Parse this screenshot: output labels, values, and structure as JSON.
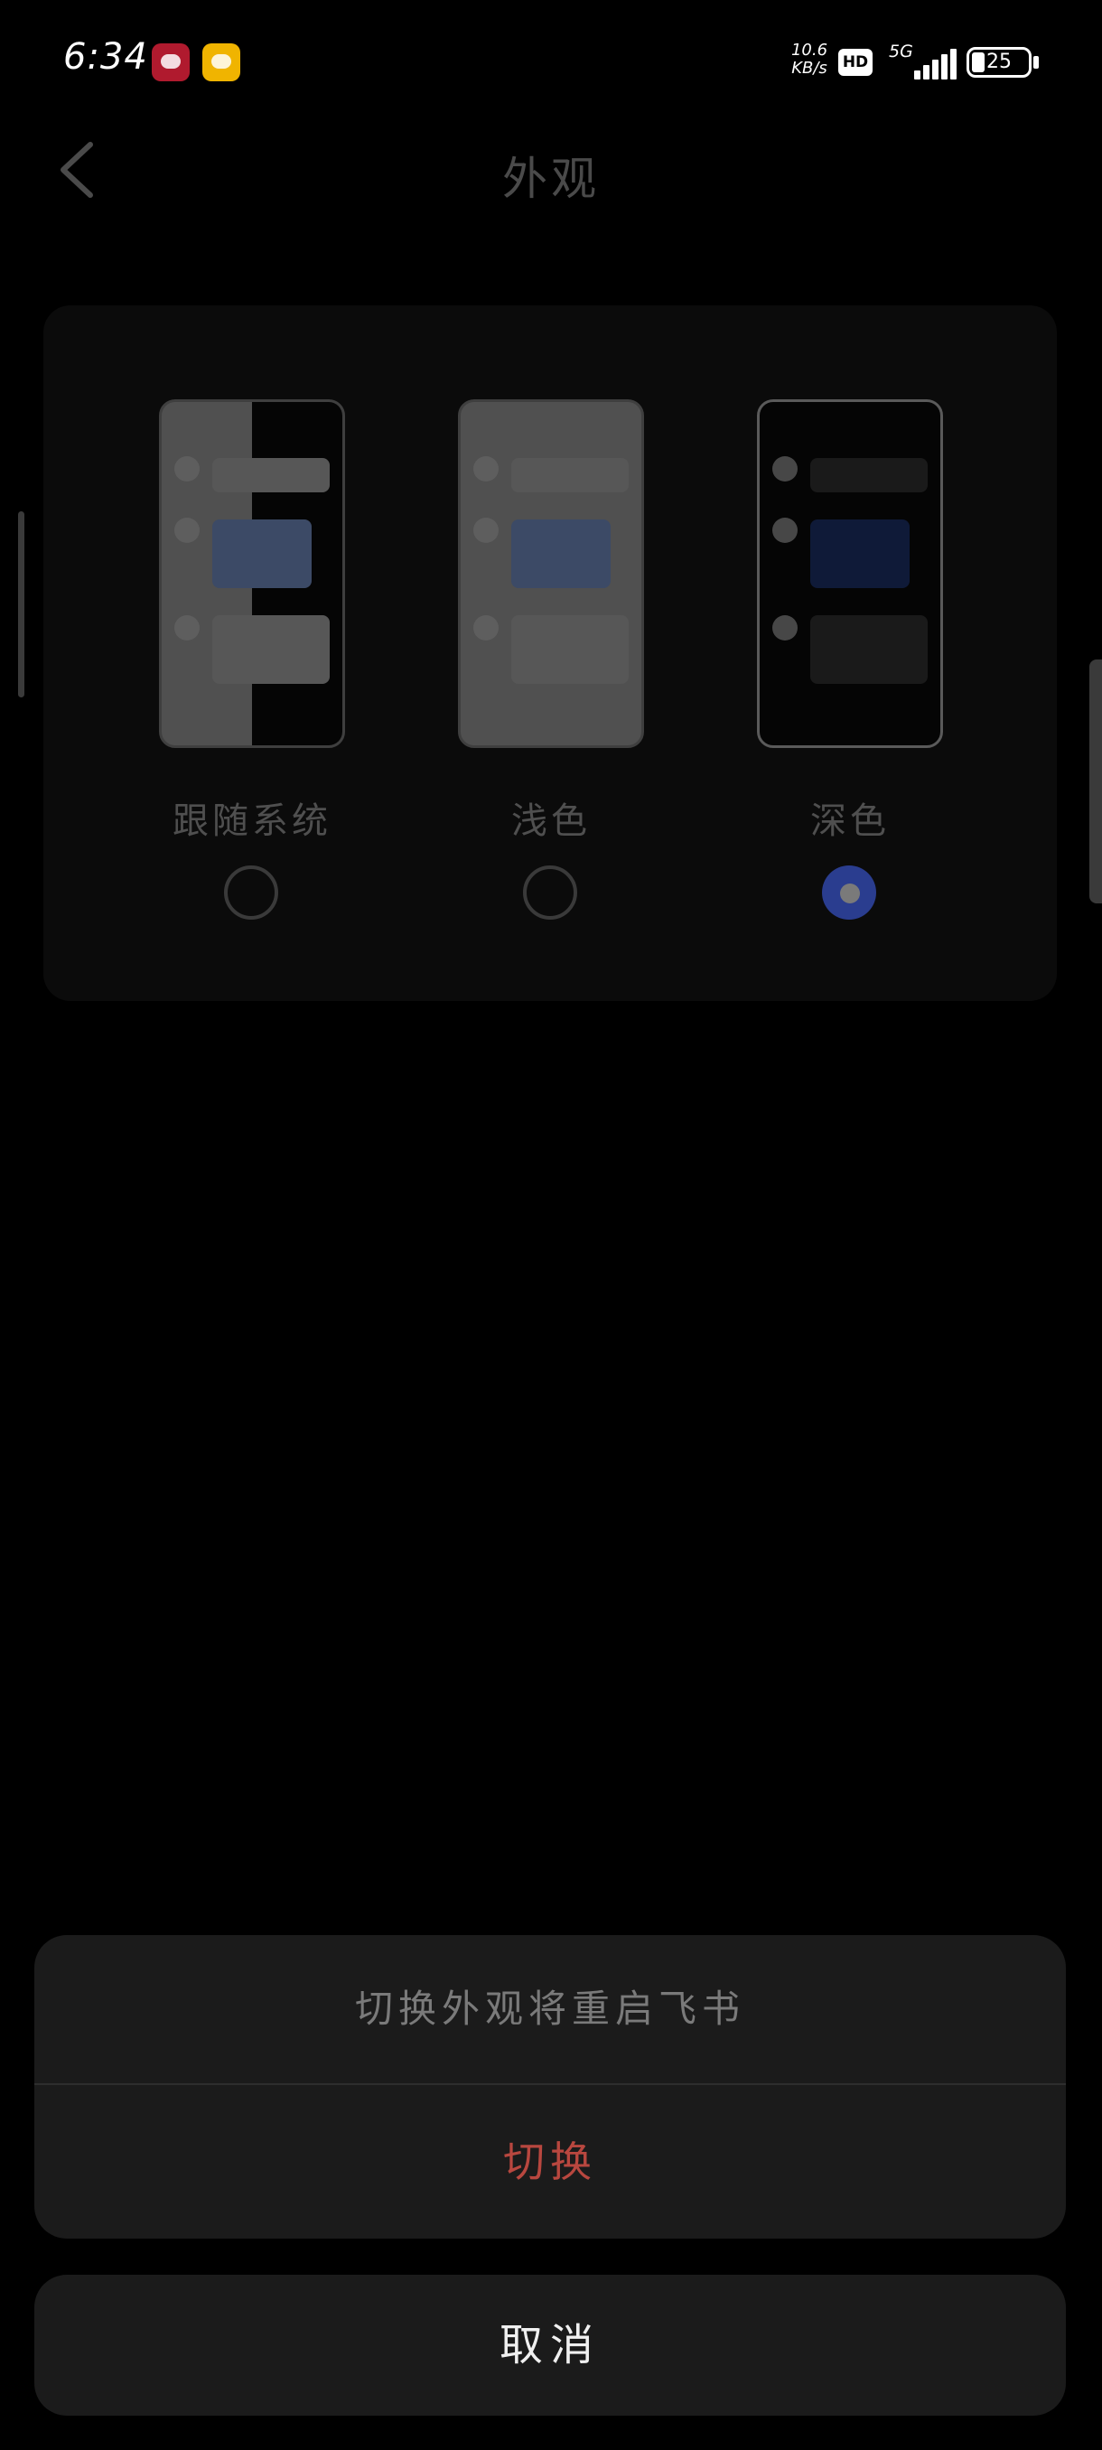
{
  "status_bar": {
    "time": "6:34",
    "net_speed_value": "10.6",
    "net_speed_unit": "KB/s",
    "hd_label": "HD",
    "network_type": "5G",
    "battery": "25",
    "icons": [
      "app-notification-icon",
      "app-notification-icon",
      "hd-icon",
      "signal-icon",
      "battery-icon"
    ]
  },
  "header": {
    "title": "外观",
    "back_icon": "chevron-left-icon"
  },
  "appearance": {
    "options": [
      {
        "label": "跟随系统",
        "selected": false
      },
      {
        "label": "浅色",
        "selected": false
      },
      {
        "label": "深色",
        "selected": true
      }
    ],
    "accent_color": "#2a3d8f"
  },
  "sheet": {
    "message": "切换外观将重启飞书",
    "confirm_label": "切换",
    "confirm_color": "#b8473f",
    "cancel_label": "取消"
  }
}
